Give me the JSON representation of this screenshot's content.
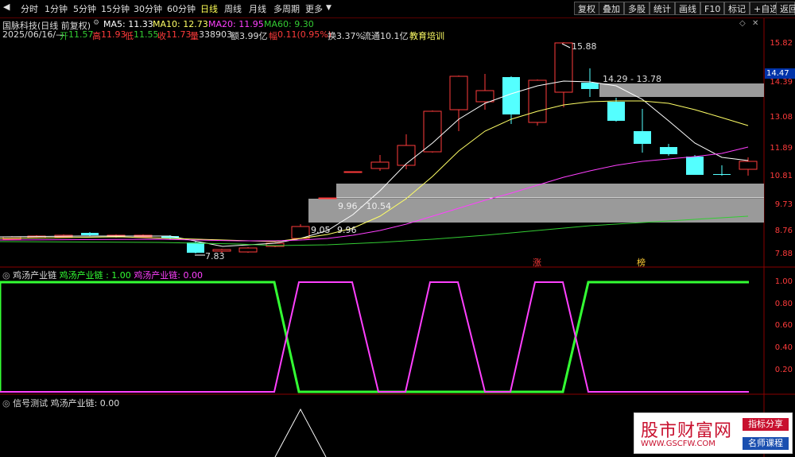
{
  "toolbar": {
    "menu": [
      "分时",
      "1分钟",
      "5分钟",
      "15分钟",
      "30分钟",
      "60分钟",
      "日线",
      "周线",
      "月线",
      "多周期",
      "更多"
    ],
    "right_buttons": [
      "复权",
      "叠加",
      "多股",
      "统计",
      "画线",
      "F10",
      "标记",
      "+自选",
      "返回"
    ]
  },
  "header": {
    "stock": "国脉科技(日线 前复权)",
    "ma5": "MA5: 11.33",
    "ma10": "MA10: 12.73",
    "ma20": "MA20: 11.95",
    "ma60": "MA60: 9.30",
    "date": "2025/06/16/—",
    "open_label": "开",
    "open": "11.57",
    "high_label": "高",
    "high": "11.93",
    "low_label": "低",
    "low": "11.55",
    "close_label": "收",
    "close": "11.73",
    "vol_label": "量",
    "vol": "338903",
    "amt_label": "额",
    "amt": "3.99亿",
    "chg_label": "幅",
    "chg": "0.11(0.95%)",
    "turnover": "换3.37%",
    "float": "流通10.1亿",
    "sector": "教育培训"
  },
  "price_axis": [
    "15.82",
    "14.39",
    "13.08",
    "11.89",
    "10.81",
    "9.73",
    "8.76",
    "7.88"
  ],
  "price_current": "14.47",
  "annotations": {
    "high_mark": "15.88",
    "low_mark": "7.83",
    "zone_top": "14.29 - 13.78",
    "zone_mid": "9.96 - 10.54",
    "zone_low_a": "9.05",
    "zone_low_b": "9.96",
    "tag_zhang": "涨",
    "tag_bang": "榜"
  },
  "panel2": {
    "title": "鸡汤产业链",
    "v1_label": "鸡汤产业链 : 1.00",
    "v2_label": "鸡汤产业链: 0.00",
    "axis": [
      "1.00",
      "0.80",
      "0.60",
      "0.40",
      "0.20"
    ]
  },
  "panel3": {
    "title": "信号测试",
    "v1_label": "鸡汤产业链: 0.00"
  },
  "watermark": {
    "name": "股市财富网",
    "tag1": "指标分享",
    "url": "WWW.GSCFW.COM",
    "tag2": "名师课程"
  },
  "colors": {
    "up": "#ff3b3b",
    "down": "#54ffff",
    "ma5": "#ffffff",
    "ma10": "#ffff66",
    "ma20": "#ff40ff",
    "ma60": "#33cc33",
    "green_line": "#33ff33",
    "magenta_line": "#ff40ff"
  }
}
